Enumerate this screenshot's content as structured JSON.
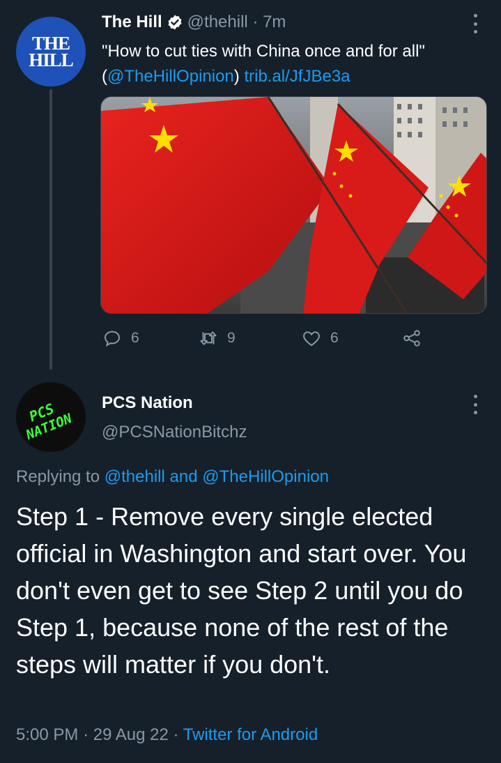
{
  "parent_tweet": {
    "avatar_text": [
      "THE",
      "HILL"
    ],
    "name": "The Hill",
    "handle": "@thehill",
    "separator": " · ",
    "time": "7m",
    "text_quote": "\"How to cut ties with China once and for all\"",
    "text_mention_open": "(",
    "mention": "@TheHillOpinion",
    "text_mention_close": ")",
    "link": "trib.al/JfJBe3a",
    "media_alt": "Chinese flags",
    "actions": {
      "replies": "6",
      "retweets": "9",
      "likes": "6"
    }
  },
  "reply_tweet": {
    "avatar_text": [
      "PCS",
      "NATION"
    ],
    "name": "PCS Nation",
    "handle": "@PCSNationBitchz",
    "replying_prefix": "Replying to ",
    "replying_to_1": "@thehill",
    "replying_and": " and ",
    "replying_to_2": "@TheHillOpinion",
    "text": "Step 1 - Remove every single elected official in Washington and start over. You don't even get to see Step 2 until you do Step 1, because none of the rest of the steps will matter if you don't.",
    "time": "5:00 PM",
    "date": "29 Aug 22",
    "source": "Twitter for Android"
  },
  "colors": {
    "background": "#15202b",
    "accent": "#1d9bf0",
    "muted": "#8b98a5",
    "flag_red": "#e01b1b",
    "pcs_green": "#3cff3c"
  }
}
